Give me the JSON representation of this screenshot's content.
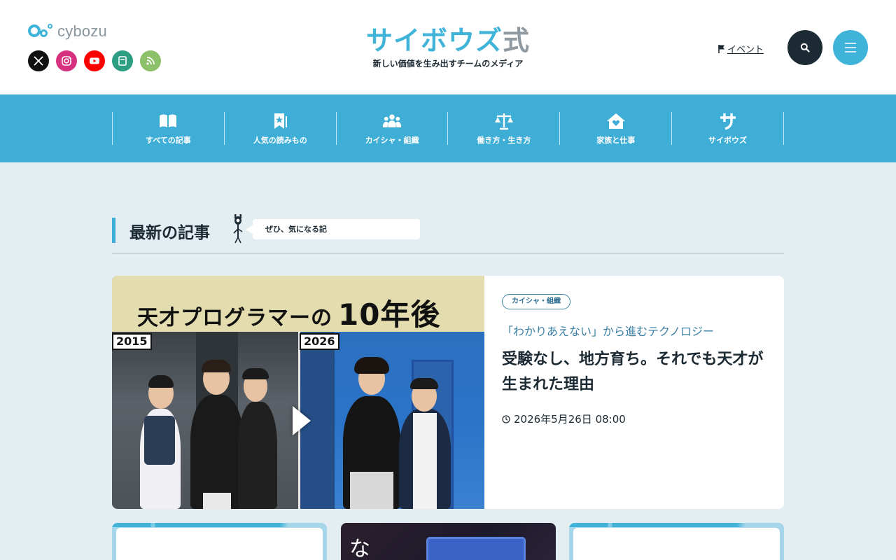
{
  "header": {
    "cybozu_logo_text": "cybozu",
    "brand_title_main": "サイボウズ",
    "brand_title_suffix": "式",
    "brand_subtitle": "新しい価値を生み出すチームのメディア",
    "event_link": "イベント",
    "socials": [
      {
        "name": "x-icon",
        "color": "#111111"
      },
      {
        "name": "instagram-icon",
        "color": "#d6317f"
      },
      {
        "name": "youtube-icon",
        "color": "#ff0000"
      },
      {
        "name": "note-icon",
        "color": "#2e9e83"
      },
      {
        "name": "rss-icon",
        "color": "#8cc16a"
      }
    ]
  },
  "nav": {
    "items": [
      {
        "label": "すべての記事",
        "icon": "book-icon"
      },
      {
        "label": "人気の読みもの",
        "icon": "bookmark-star-icon"
      },
      {
        "label": "カイシャ・組織",
        "icon": "people-icon"
      },
      {
        "label": "働き方・生き方",
        "icon": "scale-icon"
      },
      {
        "label": "家族と仕事",
        "icon": "home-heart-icon"
      },
      {
        "label": "サイボウズ",
        "icon": "sa-icon"
      }
    ]
  },
  "latest": {
    "title": "最新の記事",
    "bubble": "ぜひ、気になる記"
  },
  "featured": {
    "banner_text": "天才プログラマーの",
    "banner_big": "10年後",
    "year_left": "2015",
    "year_right": "2026",
    "tag": "カイシャ・組織",
    "series": "「わかりあえない」から進むテクノロジー",
    "title": "受験なし、地方育ち。それでも天才が生まれた理由",
    "date": "2026年5月26日 08:00"
  },
  "colors": {
    "accent": "#3eaed6",
    "dark": "#1c2a33",
    "background": "#e4edf2"
  }
}
